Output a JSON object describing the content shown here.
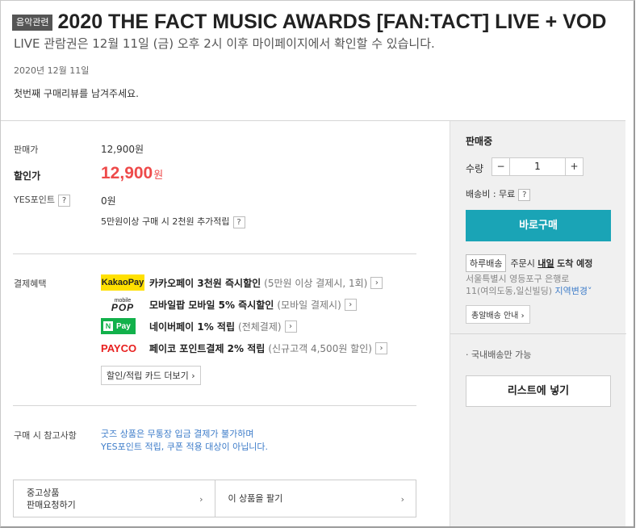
{
  "header": {
    "badge": "음악관련",
    "title": "2020 THE FACT MUSIC AWARDS [FAN:TACT] LIVE + VOD",
    "subtitle": "LIVE 관람권은 12월 11일 (금) 오후 2시 이후 마이페이지에서 확인할 수 있습니다.",
    "date": "2020년 12월 11일",
    "review_prompt": "첫번째 구매리뷰를 남겨주세요."
  },
  "pricing": {
    "list_price_label": "판매가",
    "list_price": "12,900원",
    "sale_price_label": "할인가",
    "sale_price": "12,900",
    "sale_price_unit": "원",
    "points_label": "YES포인트",
    "points_help": "?",
    "points_value": "0원",
    "extra_points": "5만원이상 구매 시 2천원 추가적립",
    "extra_points_help": "?"
  },
  "benefits": {
    "label": "결제혜택",
    "items": [
      {
        "logo": "KakaoPay",
        "text": "카카오페이 3천원 즉시할인",
        "sub": "(5만원 이상 결제시, 1회)"
      },
      {
        "logo_top": "mobile",
        "logo": "POP",
        "text": "모바일팝 모바일 5% 즉시할인",
        "sub": "(모바일 결제시)"
      },
      {
        "logo_n": "N",
        "logo": "Pay",
        "text": "네이버페이 1% 적립",
        "sub": "(전체결제)"
      },
      {
        "logo": "PAYCO",
        "text": "페이코 포인트결제 2% 적립",
        "sub": "(신규고객 4,500원 할인)"
      }
    ],
    "more_cards": "할인/적립 카드 더보기"
  },
  "notes": {
    "label": "구매 시 참고사항",
    "line1": "굿즈 상품은 무통장 입금 결제가 불가하며",
    "line2": "YES포인트 적립, 쿠폰 적용 대상이 아닙니다."
  },
  "used": {
    "line1": "중고상품",
    "line2": "판매요청하기",
    "sell": "이 상품을 팔기"
  },
  "order_panel": {
    "status": "판매중",
    "qty_label": "수량",
    "qty_minus": "−",
    "qty_value": "1",
    "qty_plus": "+",
    "shipping": "배송비 : 무료",
    "shipping_help": "?",
    "buy_now": "바로구매",
    "delivery_tag": "하루배송",
    "delivery_text_pre": "주문시",
    "delivery_day": "내일",
    "delivery_text_post": "도착 예정",
    "address_line1": "서울특별시 영등포구 은행로",
    "address_line2": "11(여의도동,일신빌딩)",
    "address_change": "지역변경",
    "dawn_delivery": "총알배송 안내",
    "domestic_only": "· 국내배송만 가능",
    "add_to_list": "리스트에 넣기"
  },
  "colors": {
    "accent_button": "#1aa4b6",
    "sale_price": "#ee4a4a",
    "link_blue": "#3d7cc9",
    "kakao_yellow": "#ffe000",
    "naver_green": "#12b14b",
    "payco_red": "#e8201f"
  }
}
